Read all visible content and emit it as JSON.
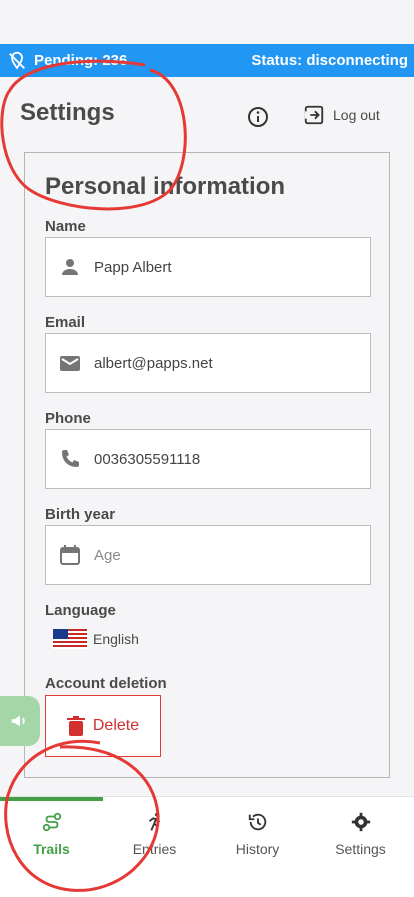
{
  "status_bar": {
    "pending": "Pending: 236",
    "status": "Status: disconnecting"
  },
  "header": {
    "title": "Settings",
    "logout_label": "Log out"
  },
  "personal": {
    "title": "Personal information",
    "name_label": "Name",
    "name_value": "Papp Albert",
    "email_label": "Email",
    "email_value": "albert@papps.net",
    "phone_label": "Phone",
    "phone_value": "0036305591118",
    "birth_label": "Birth year",
    "birth_placeholder": "Age",
    "language_label": "Language",
    "language_value": "English",
    "deletion_label": "Account deletion",
    "delete_button": "Delete"
  },
  "nav": {
    "items": [
      {
        "label": "Trails",
        "icon": "route-icon",
        "active": true
      },
      {
        "label": "Entries",
        "icon": "runner-icon",
        "active": false
      },
      {
        "label": "History",
        "icon": "history-icon",
        "active": false
      },
      {
        "label": "Settings",
        "icon": "gear-icon",
        "active": false
      }
    ]
  },
  "colors": {
    "status_bar": "#2196f3",
    "accent_green": "#43a047",
    "danger": "#d32f2f",
    "annotation": "#e53935"
  }
}
